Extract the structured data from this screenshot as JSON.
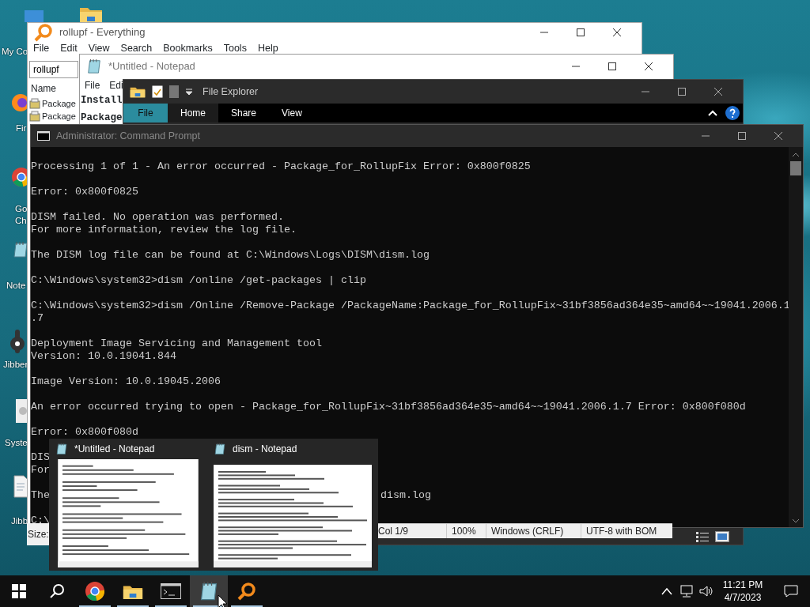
{
  "desktop": {
    "icons": [
      {
        "kind": "computer",
        "lines": [
          "My Co"
        ]
      },
      {
        "kind": "folder"
      },
      {
        "kind": "firefox",
        "lines": [
          "Fir"
        ]
      },
      {
        "kind": "chrome",
        "lines": [
          "Go",
          "Ch"
        ]
      },
      {
        "kind": "notepad",
        "lines": [
          "Note"
        ]
      },
      {
        "kind": "wrench",
        "lines": [
          "Jibber"
        ]
      },
      {
        "kind": "system",
        "lines": [
          "Syste"
        ]
      },
      {
        "kind": "document",
        "lines": [
          "Jibb"
        ]
      }
    ]
  },
  "everything": {
    "title": "rollupf - Everything",
    "menu": [
      "File",
      "Edit",
      "View",
      "Search",
      "Bookmarks",
      "Tools",
      "Help"
    ],
    "search": {
      "value": "rollupf"
    },
    "columns": [
      "Name"
    ],
    "rows": [
      "Package",
      "Package"
    ],
    "status_bar": "Size:"
  },
  "notepad": {
    "title": "*Untitled - Notepad",
    "menu": [
      "File",
      "Edi"
    ],
    "lines": [
      "Install",
      "Package"
    ],
    "status_bar": [
      "Col 1/9",
      "100%",
      "Windows (CRLF)",
      "UTF-8 with BOM"
    ]
  },
  "explorer": {
    "title": "File Explorer",
    "tabs": [
      {
        "kind": "backstage",
        "label": "File",
        "selected": false
      },
      {
        "kind": "tab",
        "label": "Home",
        "selected": true
      },
      {
        "kind": "tab",
        "label": "Share",
        "selected": false
      },
      {
        "kind": "tab",
        "label": "View",
        "selected": false
      }
    ]
  },
  "cmd": {
    "title": "Administrator: Command Prompt",
    "paragraphs": [
      [
        "Processing 1 of 1 - An error occurred - Package_for_RollupFix Error: 0x800f0825"
      ],
      [
        "Error: 0x800f0825"
      ],
      [
        "DISM failed. No operation was performed.",
        "For more information, review the log file."
      ],
      [
        "The DISM log file can be found at C:\\Windows\\Logs\\DISM\\dism.log"
      ],
      [
        "C:\\Windows\\system32>dism /online /get-packages | clip"
      ],
      [
        "C:\\Windows\\system32>dism /Online /Remove-Package /PackageName:Package_for_RollupFix~31bf3856ad364e35~amd64~~19041.2006.1",
        ".7"
      ],
      [
        "Deployment Image Servicing and Management tool",
        "Version: 10.0.19041.844"
      ],
      [
        "Image Version: 10.0.19045.2006"
      ],
      [
        "An error occurred trying to open - Package_for_RollupFix~31bf3856ad364e35~amd64~~19041.2006.1.7 Error: 0x800f080d"
      ],
      [
        "Error: 0x800f080d"
      ]
    ],
    "partial_paragraphs": [
      [
        {
          "left": "DIS"
        },
        {
          "left": "For"
        }
      ],
      [
        {
          "left": "The",
          "right": "dism.log"
        }
      ],
      [
        {
          "left": "C:\\"
        }
      ]
    ]
  },
  "preview": {
    "thumbnails": [
      {
        "title": "*Untitled - Notepad"
      },
      {
        "title": "dism - Notepad"
      }
    ]
  },
  "taskbar": {
    "apps": [
      {
        "kind": "chrome",
        "running": true,
        "selected": false
      },
      {
        "kind": "folder",
        "running": true,
        "selected": false
      },
      {
        "kind": "console",
        "running": true,
        "selected": false
      },
      {
        "kind": "notepad",
        "running": true,
        "selected": true
      },
      {
        "kind": "magnifier",
        "running": true,
        "selected": false
      }
    ],
    "time": "11:21 PM",
    "date": "4/7/2023"
  }
}
